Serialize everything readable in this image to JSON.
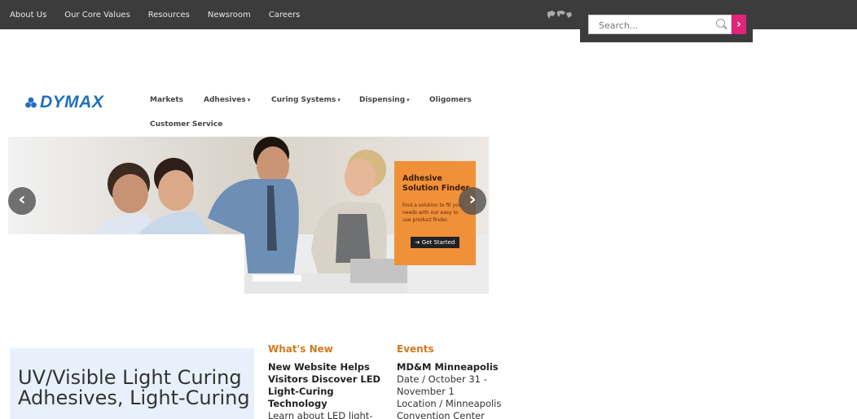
{
  "top_nav": {
    "items": [
      "About Us",
      "Our Core Values",
      "Resources",
      "Newsroom",
      "Careers"
    ]
  },
  "search": {
    "placeholder": "Search..."
  },
  "brand": {
    "logo_text": "DYMAX",
    "color": "#1f6fc0"
  },
  "main_nav": {
    "items": [
      {
        "label": "Markets",
        "dropdown": false
      },
      {
        "label": "Adhesives",
        "dropdown": true
      },
      {
        "label": "Curing Systems",
        "dropdown": true
      },
      {
        "label": "Dispensing",
        "dropdown": true
      },
      {
        "label": "Oligomers",
        "dropdown": false
      },
      {
        "label": "Customer Service",
        "dropdown": false
      }
    ]
  },
  "hero": {
    "promo_title": "Adhesive Solution Finder",
    "promo_text": "Find a solution to fit your needs with our easy to use product finder.",
    "promo_button": "Get Started",
    "accent": "#f0913a"
  },
  "feature": {
    "headline": "UV/Visible Light Curing Adhesives, Light-Curing"
  },
  "whats_new": {
    "heading": "What's New",
    "title": "New Website Helps Visitors Discover LED Light-Curing Technology",
    "body": "Learn about LED light-"
  },
  "events": {
    "heading": "Events",
    "title": "MD&M Minneapolis",
    "date": "Date / October 31 - November 1",
    "location": "Location / Minneapolis Convention Center"
  },
  "colors": {
    "topbar": "#3c3c3c",
    "heading_orange": "#d4781e",
    "search_button": "#e0247a"
  }
}
